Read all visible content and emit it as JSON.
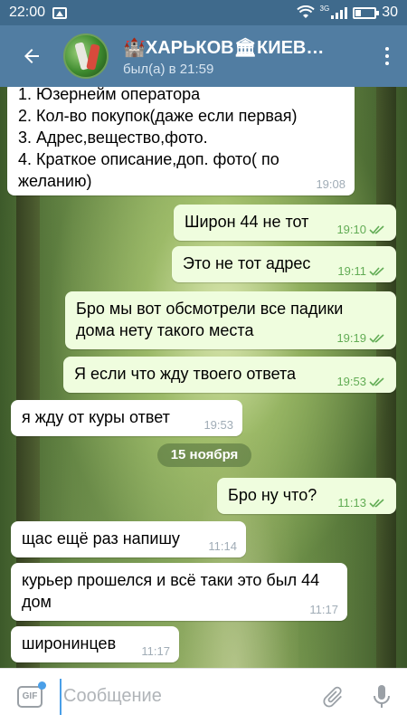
{
  "status_bar": {
    "time": "22:00",
    "network": "3G",
    "battery": "30",
    "battery_level": 0.3
  },
  "header": {
    "title": "🏰ХАРЬКОВ🏛КИЕВ…",
    "status": "был(а) в 21:59"
  },
  "date_separator": "15 ноября",
  "messages": [
    {
      "dir": "in",
      "text": "1. Юзернейм оператора\n2. Кол-во покупок(даже если первая)\n3. Адрес,вещество,фото.\n4. Краткое описание,доп. фото( по желанию)",
      "time": "19:08"
    },
    {
      "dir": "out",
      "text": "Широн 44 не тот",
      "time": "19:10"
    },
    {
      "dir": "out",
      "text": "Это не тот адрес",
      "time": "19:11"
    },
    {
      "dir": "out",
      "text": "Бро мы вот обсмотрели все падики дома нету такого места",
      "time": "19:19"
    },
    {
      "dir": "out",
      "text": "Я если что жду твоего ответа",
      "time": "19:53"
    },
    {
      "dir": "in",
      "text": "я жду от куры ответ",
      "time": "19:53"
    },
    {
      "dir": "out",
      "text": "Бро ну что?",
      "time": "11:13"
    },
    {
      "dir": "in",
      "text": "щас ещё раз напишу",
      "time": "11:14"
    },
    {
      "dir": "in",
      "text": "курьер прошелся и всё таки это был 44 дом",
      "time": "11:17"
    },
    {
      "dir": "in",
      "text": "широнинцев",
      "time": "11:17"
    }
  ],
  "composer": {
    "placeholder": "Сообщение",
    "gif_label": "GIF"
  },
  "colors": {
    "header": "#517da2",
    "status_bar": "#3f6a8c",
    "outgoing_bubble": "#effdde",
    "incoming_bubble": "#ffffff",
    "read_check": "#62ac55",
    "accent": "#4a9fe8"
  },
  "icons": [
    "back-arrow-icon",
    "menu-dots-icon",
    "gif-icon",
    "paperclip-icon",
    "microphone-icon",
    "double-check-icon",
    "wifi-icon",
    "signal-icon",
    "battery-icon",
    "image-notification-icon"
  ]
}
